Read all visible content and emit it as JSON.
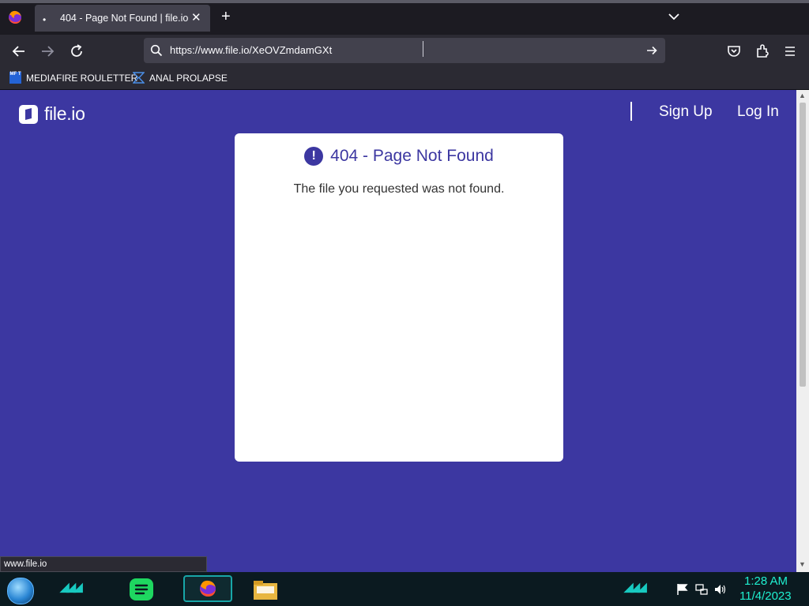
{
  "browser": {
    "tab": {
      "title": "404 - Page Not Found | file.io"
    },
    "url": "https://www.file.io/XeOVZmdamGXt",
    "bookmarks": [
      {
        "icon": "mediafire-icon",
        "badge": "MF T",
        "label": "MEDIAFIRE ROULETTER"
      },
      {
        "icon": "bookmark-sigma-icon",
        "label": "ANAL PROLAPSE"
      }
    ],
    "status_url": "www.file.io"
  },
  "site": {
    "logo_text": "file.io",
    "nav": {
      "signup": "Sign Up",
      "login": "Log In"
    }
  },
  "error_card": {
    "icon_glyph": "!",
    "title": "404 - Page Not Found",
    "message": "The file you requested was not found."
  },
  "taskbar": {
    "time": "1:28 AM",
    "date": "11/4/2023",
    "accent_color": "#1ff0d0"
  },
  "colors": {
    "page_bg": "#3c37a1",
    "card_bg": "#ffffff",
    "browser_chrome": "#2b2a33"
  }
}
